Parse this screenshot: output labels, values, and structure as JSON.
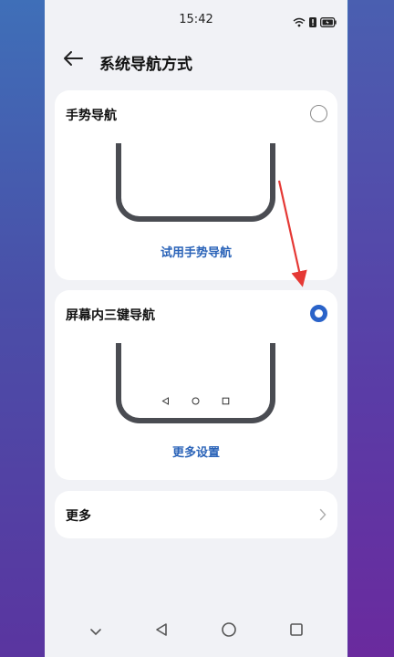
{
  "status_bar": {
    "time": "15:42"
  },
  "header": {
    "title": "系统导航方式"
  },
  "options": [
    {
      "title": "手势导航",
      "selected": false,
      "link": "试用手势导航"
    },
    {
      "title": "屏幕内三键导航",
      "selected": true,
      "link": "更多设置"
    }
  ],
  "more": {
    "label": "更多"
  },
  "colors": {
    "accent": "#2a63c9",
    "link": "#2a63b8",
    "annotation_arrow": "#e53935"
  }
}
